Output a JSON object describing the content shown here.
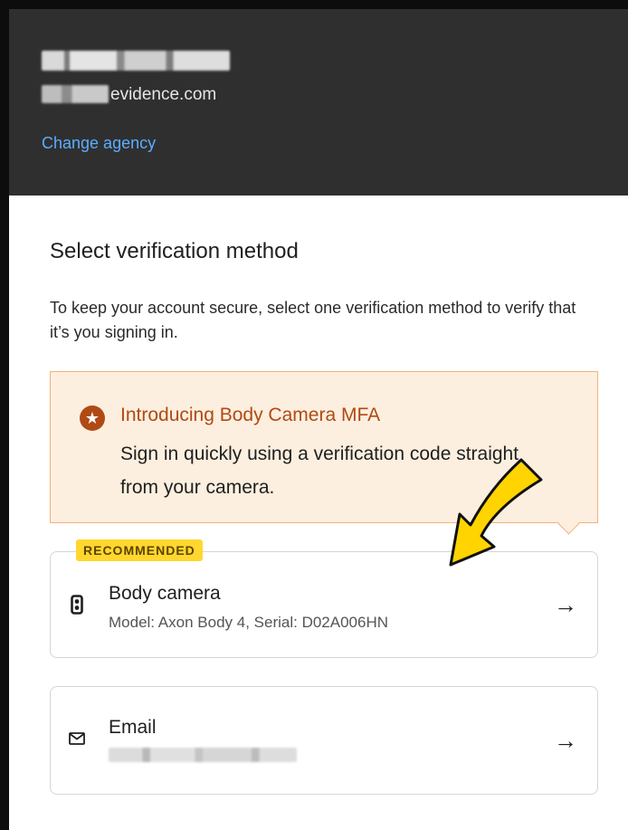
{
  "header": {
    "agency_name_obscured": "████████ ████ ███",
    "domain_suffix": "evidence.com",
    "change_agency_label": "Change agency"
  },
  "main": {
    "title": "Select verification method",
    "description": "To keep your account secure, select one verification method to verify that it’s you signing in."
  },
  "promo": {
    "title": "Introducing Body Camera MFA",
    "text": "Sign in quickly using a verification code straight from your camera.",
    "icon": "star-circle-icon",
    "accent_color": "#b04a14",
    "background_color": "#fcefdf"
  },
  "methods": [
    {
      "badge": "RECOMMENDED",
      "icon": "body-camera-icon",
      "title": "Body camera",
      "subtitle": "Model: Axon Body 4, Serial: D02A006HN",
      "arrow_icon": "arrow-right-icon"
    },
    {
      "icon": "mail-icon",
      "title": "Email",
      "subtitle_obscured": "██████████████",
      "arrow_icon": "arrow-right-icon"
    }
  ],
  "colors": {
    "header_bg": "#2f2f2f",
    "link": "#5aaeff",
    "badge_bg": "#ffd72e",
    "annotation_arrow": "#ffd400"
  }
}
